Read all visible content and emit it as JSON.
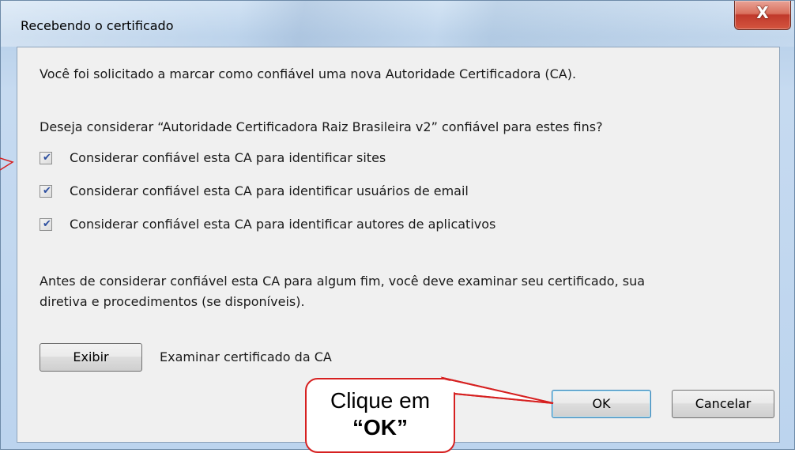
{
  "window": {
    "title": "Recebendo o certificado",
    "close_glyph": "X"
  },
  "dialog": {
    "intro": "Você foi solicitado a marcar como confiável uma nova Autoridade Certificadora (CA).",
    "question": "Deseja considerar “Autoridade Certificadora Raiz Brasileira v2” confiável para estes fins?",
    "options": [
      {
        "label": "Considerar confiável esta CA para identificar sites",
        "checked": true
      },
      {
        "label": "Considerar confiável esta CA para identificar usuários de email",
        "checked": true
      },
      {
        "label": "Considerar confiável esta CA para identificar autores de aplicativos",
        "checked": true
      }
    ],
    "warning_line1": "Antes de considerar confiável esta CA para algum fim, você deve examinar seu certificado, sua",
    "warning_line2": "diretiva e procedimentos (se disponíveis).",
    "view_button": "Exibir",
    "view_description": "Examinar certificado da CA",
    "ok_button": "OK",
    "cancel_button": "Cancelar"
  },
  "annotation": {
    "line1": "Clique em",
    "line2": "“OK”",
    "color": "#d62020"
  },
  "check_mark": "✔"
}
